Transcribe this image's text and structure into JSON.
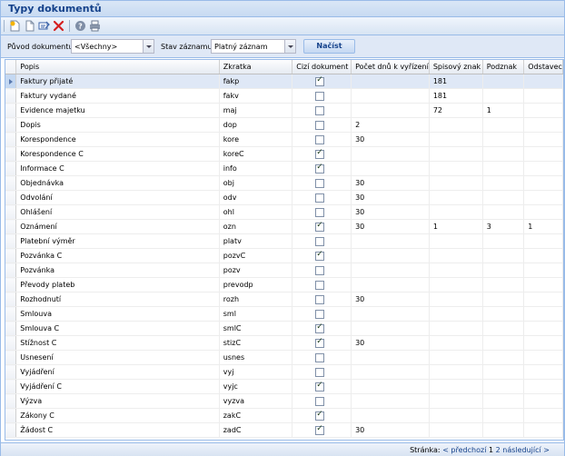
{
  "window": {
    "title": "Typy dokumentů"
  },
  "toolbar": {
    "icons": [
      "new-document-icon",
      "copy-icon",
      "edit-icon",
      "delete-icon",
      "help-icon",
      "print-icon"
    ]
  },
  "filters": {
    "origin_label": "Původ dokumentu:",
    "origin_value": "<Všechny>",
    "state_label": "Stav záznamu:",
    "state_value": "Platný záznam",
    "load_button": "Načíst"
  },
  "grid": {
    "columns": [
      "Popis",
      "Zkratka",
      "Cizí dokument",
      "Počet dnů k vyřízení",
      "Spisový znak",
      "Podznak",
      "Odstavec"
    ],
    "rows": [
      {
        "popis": "Faktury přijaté",
        "zkratka": "fakp",
        "cizi": true,
        "dny": "",
        "znak": "181",
        "podznak": "",
        "odstavec": ""
      },
      {
        "popis": "Faktury vydané",
        "zkratka": "fakv",
        "cizi": false,
        "dny": "",
        "znak": "181",
        "podznak": "",
        "odstavec": ""
      },
      {
        "popis": "Evidence majetku",
        "zkratka": "maj",
        "cizi": false,
        "dny": "",
        "znak": "72",
        "podznak": "1",
        "odstavec": ""
      },
      {
        "popis": "Dopis",
        "zkratka": "dop",
        "cizi": false,
        "dny": "2",
        "znak": "",
        "podznak": "",
        "odstavec": ""
      },
      {
        "popis": "Korespondence",
        "zkratka": "kore",
        "cizi": false,
        "dny": "30",
        "znak": "",
        "podznak": "",
        "odstavec": ""
      },
      {
        "popis": "Korespondence C",
        "zkratka": "koreC",
        "cizi": true,
        "dny": "",
        "znak": "",
        "podznak": "",
        "odstavec": ""
      },
      {
        "popis": "Informace C",
        "zkratka": "info",
        "cizi": true,
        "dny": "",
        "znak": "",
        "podznak": "",
        "odstavec": ""
      },
      {
        "popis": "Objednávka",
        "zkratka": "obj",
        "cizi": false,
        "dny": "30",
        "znak": "",
        "podznak": "",
        "odstavec": ""
      },
      {
        "popis": "Odvolání",
        "zkratka": "odv",
        "cizi": false,
        "dny": "30",
        "znak": "",
        "podznak": "",
        "odstavec": ""
      },
      {
        "popis": "Ohlášení",
        "zkratka": "ohl",
        "cizi": false,
        "dny": "30",
        "znak": "",
        "podznak": "",
        "odstavec": ""
      },
      {
        "popis": "Oznámení",
        "zkratka": "ozn",
        "cizi": true,
        "dny": "30",
        "znak": "1",
        "podznak": "3",
        "odstavec": "1"
      },
      {
        "popis": "Platební výměr",
        "zkratka": "platv",
        "cizi": false,
        "dny": "",
        "znak": "",
        "podznak": "",
        "odstavec": ""
      },
      {
        "popis": "Pozvánka C",
        "zkratka": "pozvC",
        "cizi": true,
        "dny": "",
        "znak": "",
        "podznak": "",
        "odstavec": ""
      },
      {
        "popis": "Pozvánka",
        "zkratka": "pozv",
        "cizi": false,
        "dny": "",
        "znak": "",
        "podznak": "",
        "odstavec": ""
      },
      {
        "popis": "Převody plateb",
        "zkratka": "prevodp",
        "cizi": false,
        "dny": "",
        "znak": "",
        "podznak": "",
        "odstavec": ""
      },
      {
        "popis": "Rozhodnutí",
        "zkratka": "rozh",
        "cizi": false,
        "dny": "30",
        "znak": "",
        "podznak": "",
        "odstavec": ""
      },
      {
        "popis": "Smlouva",
        "zkratka": "sml",
        "cizi": false,
        "dny": "",
        "znak": "",
        "podznak": "",
        "odstavec": ""
      },
      {
        "popis": "Smlouva C",
        "zkratka": "smlC",
        "cizi": true,
        "dny": "",
        "znak": "",
        "podznak": "",
        "odstavec": ""
      },
      {
        "popis": "Stížnost C",
        "zkratka": "stizC",
        "cizi": true,
        "dny": "30",
        "znak": "",
        "podznak": "",
        "odstavec": ""
      },
      {
        "popis": "Usnesení",
        "zkratka": "usnes",
        "cizi": false,
        "dny": "",
        "znak": "",
        "podznak": "",
        "odstavec": ""
      },
      {
        "popis": "Vyjádření",
        "zkratka": "vyj",
        "cizi": false,
        "dny": "",
        "znak": "",
        "podznak": "",
        "odstavec": ""
      },
      {
        "popis": "Vyjádření C",
        "zkratka": "vyjc",
        "cizi": true,
        "dny": "",
        "znak": "",
        "podznak": "",
        "odstavec": ""
      },
      {
        "popis": "Výzva",
        "zkratka": "vyzva",
        "cizi": false,
        "dny": "",
        "znak": "",
        "podznak": "",
        "odstavec": ""
      },
      {
        "popis": "Zákony C",
        "zkratka": "zakC",
        "cizi": true,
        "dny": "",
        "znak": "",
        "podznak": "",
        "odstavec": ""
      },
      {
        "popis": "Žádost C",
        "zkratka": "zadC",
        "cizi": true,
        "dny": "30",
        "znak": "",
        "podznak": "",
        "odstavec": ""
      }
    ],
    "selected_row": 0
  },
  "pager": {
    "label": "Stránka:",
    "prev": "< předchozí",
    "page1": "1",
    "page2": "2",
    "next": "následující >"
  }
}
